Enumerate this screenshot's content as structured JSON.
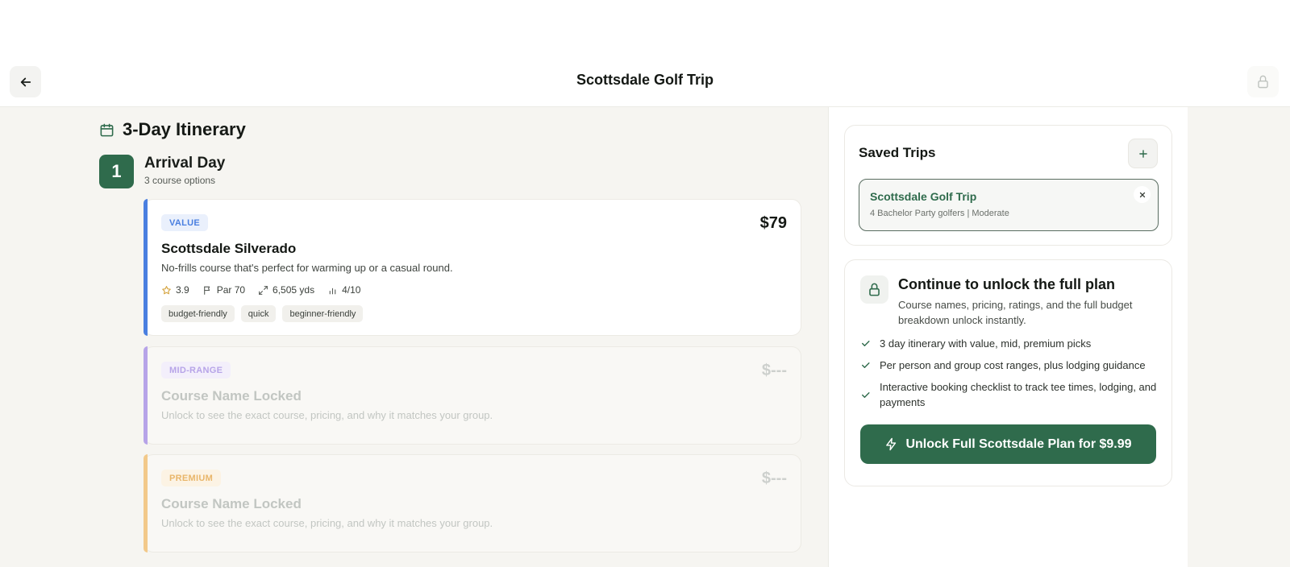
{
  "header": {
    "title": "Scottsdale Golf Trip"
  },
  "itinerary": {
    "title": "3-Day Itinerary",
    "day": {
      "number": "1",
      "title": "Arrival Day",
      "subtitle": "3 course options"
    },
    "cards": [
      {
        "tier": "VALUE",
        "price": "$79",
        "name": "Scottsdale Silverado",
        "description": "No-frills course that's perfect for warming up or a casual round.",
        "rating": "3.9",
        "par": "Par 70",
        "yardage": "6,505 yds",
        "difficulty": "4/10",
        "tags": [
          "budget-friendly",
          "quick",
          "beginner-friendly"
        ]
      },
      {
        "tier": "MID-RANGE",
        "price": "$---",
        "name": "Course Name Locked",
        "description": "Unlock to see the exact course, pricing, and why it matches your group."
      },
      {
        "tier": "PREMIUM",
        "price": "$---",
        "name": "Course Name Locked",
        "description": "Unlock to see the exact course, pricing, and why it matches your group."
      }
    ]
  },
  "saved_trips": {
    "title": "Saved Trips",
    "items": [
      {
        "name": "Scottsdale Golf Trip",
        "meta": "4 Bachelor Party golfers | Moderate"
      }
    ]
  },
  "unlock": {
    "title": "Continue to unlock the full plan",
    "description": "Course names, pricing, ratings, and the full budget breakdown unlock instantly.",
    "features": [
      "3 day itinerary with value, mid, premium picks",
      "Per person and group cost ranges, plus lodging guidance",
      "Interactive booking checklist to track tee times, lodging, and payments"
    ],
    "cta": "Unlock Full Scottsdale Plan for $9.99"
  },
  "colors": {
    "brand_green": "#2f6b4c",
    "value_accent": "#4a7fe0",
    "midrange_accent": "#b7a4e8",
    "premium_accent": "#f2c98a"
  }
}
